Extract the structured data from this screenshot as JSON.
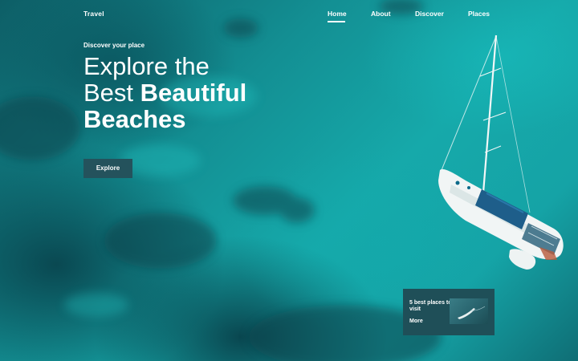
{
  "brand": "Travel",
  "nav": {
    "items": [
      {
        "label": "Home",
        "active": true
      },
      {
        "label": "About",
        "active": false
      },
      {
        "label": "Discover",
        "active": false
      },
      {
        "label": "Places",
        "active": false
      }
    ]
  },
  "hero": {
    "kicker": "Discover your place",
    "headline_line1": "Explore the",
    "headline_line2_regular": "Best",
    "headline_line2_bold": "Beautiful",
    "headline_line3_bold": "Beaches",
    "cta_label": "Explore"
  },
  "card": {
    "title": "5 best places to visit",
    "link_label": "More"
  },
  "colors": {
    "sea": "#16a9aa",
    "deep_sea": "#0d5e66",
    "button_bg": "#24525c",
    "card_bg": "#1f4f58",
    "text": "#ffffff"
  }
}
